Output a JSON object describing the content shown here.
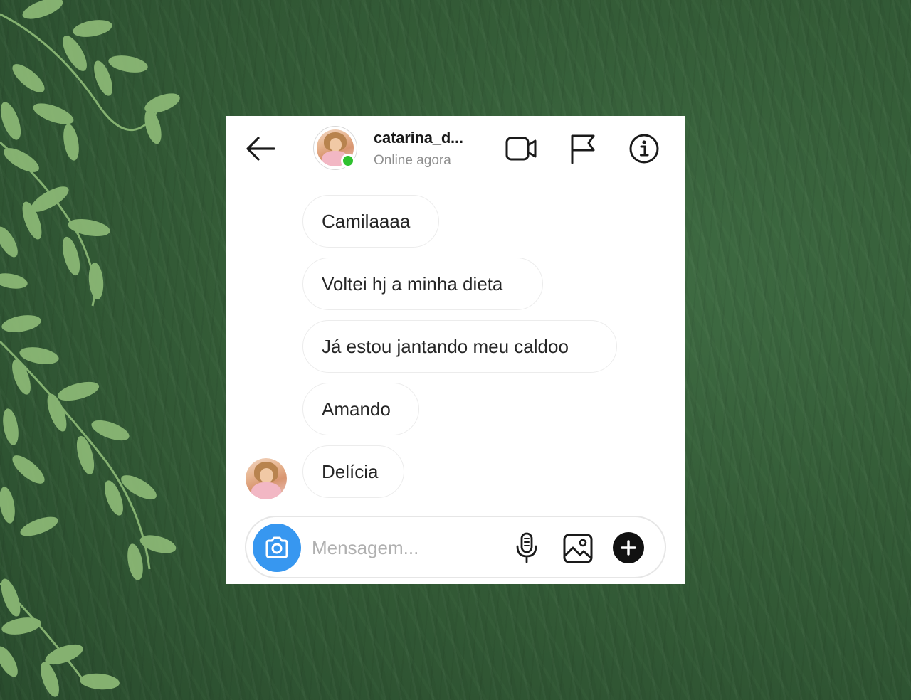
{
  "header": {
    "username": "catarina_d...",
    "status": "Online agora"
  },
  "messages": [
    {
      "text": "Camilaaaa"
    },
    {
      "text": "Voltei hj a minha dieta"
    },
    {
      "text": "Já estou jantando meu caldoo"
    },
    {
      "text": "Amando"
    },
    {
      "text": "Delícia"
    }
  ],
  "composer": {
    "placeholder": "Mensagem...",
    "value": ""
  },
  "icons": {
    "back": "arrow-left-icon",
    "video": "video-camera-icon",
    "flag": "flag-icon",
    "info": "info-icon",
    "camera": "camera-icon",
    "mic": "microphone-icon",
    "gallery": "image-icon",
    "plus": "plus-icon"
  },
  "colors": {
    "online": "#2fc12f",
    "camera_button": "#3797f0",
    "background": "#345c37",
    "leaves": "#8fbc78"
  }
}
